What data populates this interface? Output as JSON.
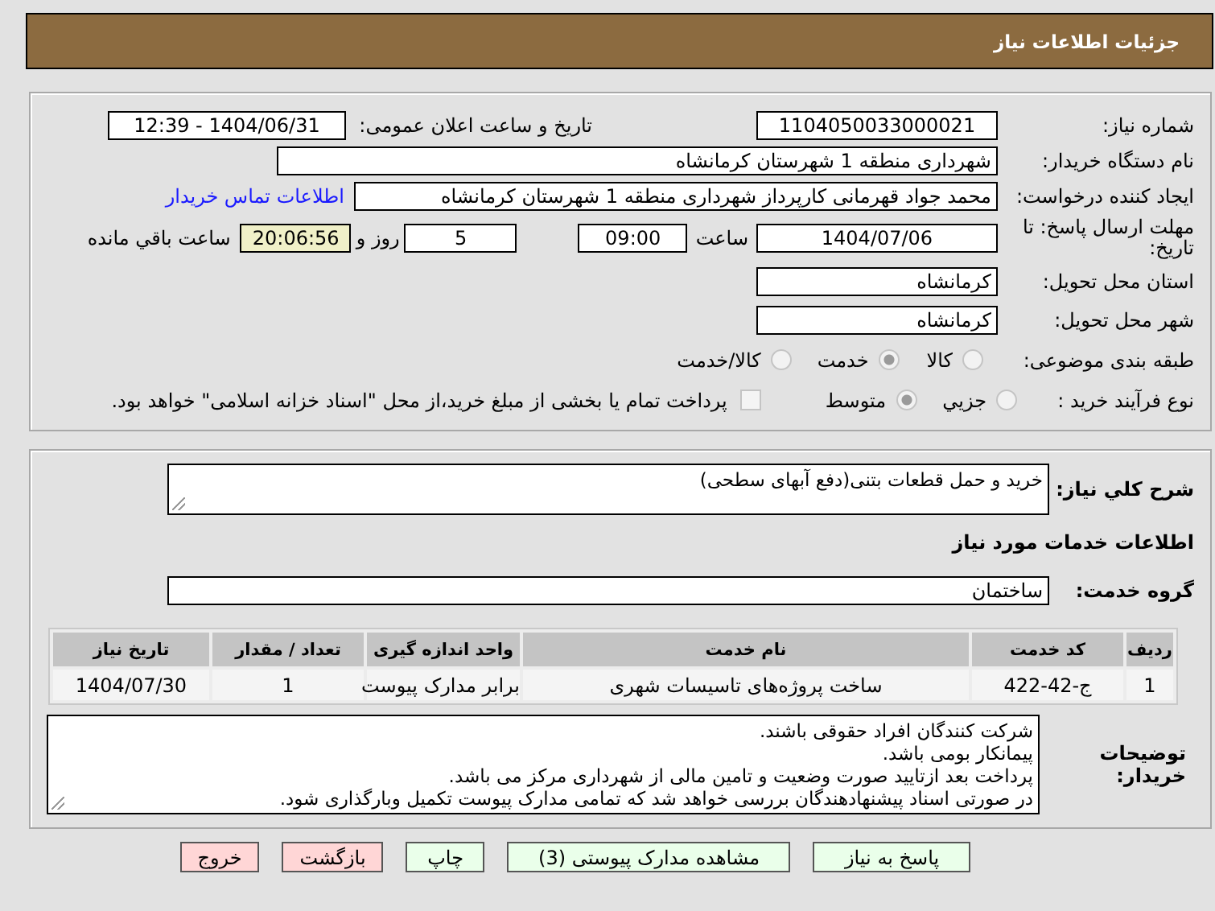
{
  "header": {
    "title": "جزئیات اطلاعات نیاز"
  },
  "details": {
    "need_number": {
      "label": "شماره نیاز:",
      "value": "1104050033000021"
    },
    "announce_date": {
      "label": "تاریخ و ساعت اعلان عمومی:",
      "value": "1404/06/31 - 12:39"
    },
    "buyer_org": {
      "label": "نام دستگاه خریدار:",
      "value": "شهرداری منطقه 1 شهرستان کرمانشاه"
    },
    "creator": {
      "label": "ایجاد کننده درخواست:",
      "value": "محمد جواد قهرمانی کارپرداز شهرداری منطقه 1 شهرستان کرمانشاه",
      "link": "اطلاعات تماس خریدار"
    },
    "deadline": {
      "label": "مهلت ارسال پاسخ: تا تاریخ:",
      "date": "1404/07/06",
      "time_label": "ساعت",
      "time": "09:00",
      "days": "5",
      "days_label": "روز و",
      "remaining": "20:06:56",
      "remaining_label": "ساعت باقي مانده"
    },
    "province": {
      "label": "استان محل تحویل:",
      "value": "کرمانشاه"
    },
    "city": {
      "label": "شهر محل تحویل:",
      "value": "کرمانشاه"
    },
    "category": {
      "label": "طبقه بندی موضوعی:",
      "options": [
        {
          "label": "کالا",
          "selected": false
        },
        {
          "label": "خدمت",
          "selected": true
        },
        {
          "label": "کالا/خدمت",
          "selected": false
        }
      ]
    },
    "purchase_type": {
      "label": "نوع فرآیند خرید :",
      "options": [
        {
          "label": "جزیي",
          "selected": false
        },
        {
          "label": "متوسط",
          "selected": true
        }
      ],
      "treasury": {
        "label": "پرداخت تمام یا بخشی از مبلغ خرید،از محل \"اسناد خزانه اسلامی\" خواهد بود.",
        "checked": false
      }
    }
  },
  "summary": {
    "label": "شرح کلي نیاز:",
    "value": "خرید و حمل قطعات بتنی(دفع آبهای سطحی)"
  },
  "services_heading": "اطلاعات خدمات مورد نیاز",
  "service_group": {
    "label": "گروه خدمت:",
    "value": "ساختمان"
  },
  "table": {
    "columns": [
      "ردیف",
      "کد خدمت",
      "نام خدمت",
      "واحد اندازه گیری",
      "تعداد / مقدار",
      "تاریخ نیاز"
    ],
    "rows": [
      [
        "1",
        "ج-42-422",
        "ساخت پروژه‌های تاسیسات شهری",
        "برابر مدارک پیوست",
        "1",
        "1404/07/30"
      ]
    ]
  },
  "buyer_notes": {
    "label": "توضیحات خریدار:",
    "lines": [
      "شرکت کنندگان افراد حقوقی باشند.",
      "پیمانکار بومی باشد.",
      "پرداخت بعد ازتایید صورت وضعیت و تامین مالی از شهرداری مرکز می باشد.",
      "در صورتی  اسناد پیشنهادهندگان بررسی خواهد شد که تمامی مدارک پیوست تکمیل وبارگذاری شود."
    ]
  },
  "buttons": [
    {
      "label": "پاسخ به نیاز",
      "kind": "normal"
    },
    {
      "label": "مشاهده مدارک پیوستی (3)",
      "kind": "normal"
    },
    {
      "label": "چاپ",
      "kind": "normal"
    },
    {
      "label": "بازگشت",
      "kind": "danger"
    },
    {
      "label": "خروج",
      "kind": "danger"
    }
  ]
}
